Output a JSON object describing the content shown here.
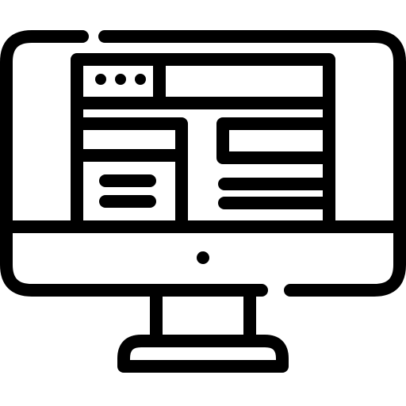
{
  "icon": {
    "name": "desktop-monitor-webpage-icon",
    "stroke_color": "#000000",
    "fill_color": "#ffffff",
    "parts": [
      "monitor-frame",
      "screen",
      "browser-window",
      "window-dots",
      "address-bar",
      "sidebar-panel",
      "content-card",
      "text-lines",
      "monitor-chin",
      "power-dot",
      "stand-neck",
      "stand-base"
    ]
  }
}
